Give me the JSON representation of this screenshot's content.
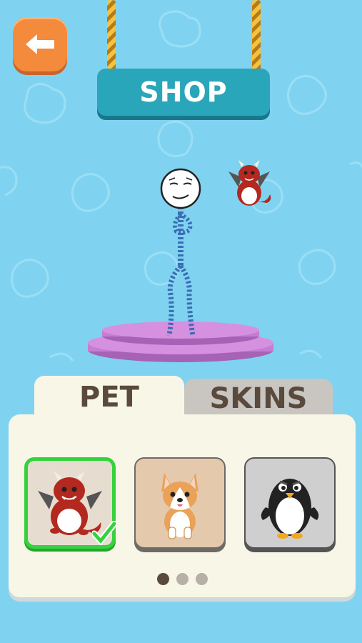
{
  "header": {
    "title": "SHOP",
    "back_icon": "back-arrow-icon"
  },
  "tabs": [
    {
      "label": "PET",
      "active": true
    },
    {
      "label": "SKINS",
      "active": false
    }
  ],
  "pets": [
    {
      "name": "dragon",
      "icon": "dragon-icon",
      "selected": true
    },
    {
      "name": "corgi",
      "icon": "corgi-icon",
      "selected": false
    },
    {
      "name": "penguin",
      "icon": "penguin-icon",
      "selected": false
    }
  ],
  "pagination": {
    "current": 1,
    "total": 3
  },
  "colors": {
    "background": "#7fd3f0",
    "sign": "#2aa6ba",
    "back_button": "#f38a3c",
    "selected_border": "#35d23d",
    "podium": "#c57cd3"
  }
}
